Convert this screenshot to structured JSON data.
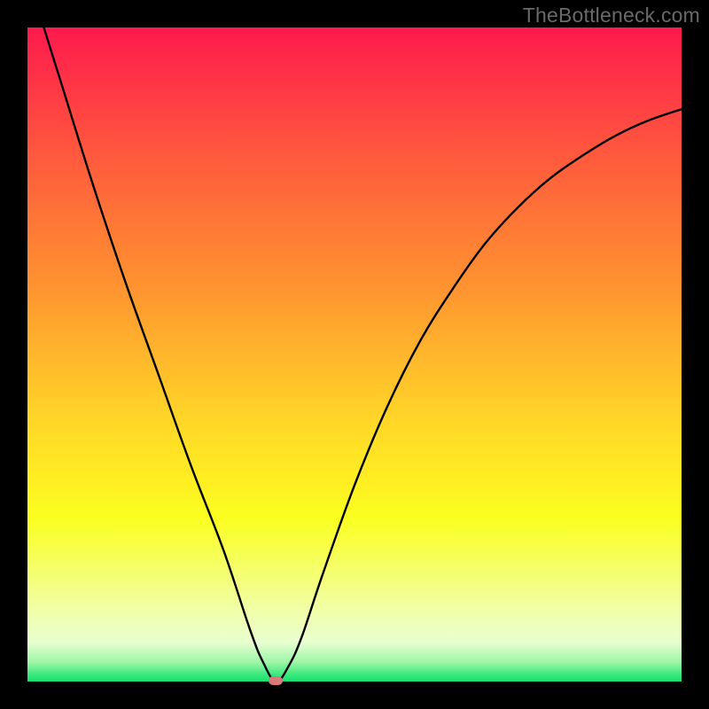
{
  "watermark": {
    "text": "TheBottleneck.com"
  },
  "chart_data": {
    "type": "line",
    "title": "",
    "xlabel": "",
    "ylabel": "",
    "xlim": [
      0,
      100
    ],
    "ylim": [
      0,
      100
    ],
    "x_opt": 38,
    "series": [
      {
        "name": "bottleneck-curve",
        "x": [
          0,
          5,
          10,
          15,
          20,
          25,
          30,
          34,
          36,
          38,
          40,
          42,
          45,
          50,
          55,
          60,
          65,
          70,
          75,
          80,
          85,
          90,
          95,
          100
        ],
        "values": [
          108,
          92,
          76,
          61,
          47,
          33,
          20,
          8,
          3,
          0,
          2.5,
          7,
          16,
          30,
          42,
          52,
          60,
          67,
          72.5,
          77,
          80.5,
          83.5,
          85.8,
          87.5
        ]
      }
    ],
    "marker": {
      "x": 38,
      "y": 0,
      "color": "#d97a7a"
    },
    "gradient_stops": [
      {
        "pos": 0,
        "color": "#ff1a4d"
      },
      {
        "pos": 50,
        "color": "#ffb62c"
      },
      {
        "pos": 75,
        "color": "#faff20"
      },
      {
        "pos": 100,
        "color": "#18e070"
      }
    ]
  }
}
